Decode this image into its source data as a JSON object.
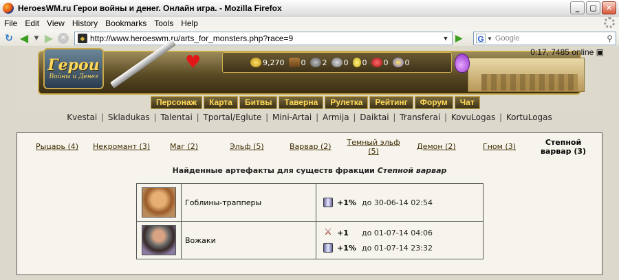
{
  "window": {
    "title": "HeroesWM.ru Герои войны и денег. Онлайн игра. - Mozilla Firefox",
    "minimize": "_",
    "maximize": "▢",
    "close": "✕"
  },
  "menubar": [
    "File",
    "Edit",
    "View",
    "History",
    "Bookmarks",
    "Tools",
    "Help"
  ],
  "nav": {
    "url": "http://www.heroeswm.ru/arts_for_monsters.php?race=9",
    "search_placeholder": "Google"
  },
  "game": {
    "logo_big": "Герои",
    "logo_small": "Войны и Денег",
    "online": "0:17, 7485 online",
    "resources": [
      {
        "name": "gold",
        "value": "9,270"
      },
      {
        "name": "wood",
        "value": "0"
      },
      {
        "name": "ore",
        "value": "2"
      },
      {
        "name": "mercury",
        "value": "0"
      },
      {
        "name": "sulfur",
        "value": "0"
      },
      {
        "name": "crystals",
        "value": "0"
      },
      {
        "name": "gems",
        "value": "0"
      }
    ],
    "menu": [
      "Персонаж",
      "Карта",
      "Битвы",
      "Таверна",
      "Рулетка",
      "Рейтинг",
      "Форум",
      "Чат"
    ],
    "sublinks": [
      "Kvestai",
      "Skladukas",
      "Talentai",
      "Tportal/Eglute",
      "Mini-Artai",
      "Armija",
      "Daiktai",
      "Transferai",
      "KovuLogas",
      "KortuLogas"
    ]
  },
  "factions": [
    {
      "label": "Рыцарь (4)"
    },
    {
      "label": "Некромант (3)"
    },
    {
      "label": "Маг (2)"
    },
    {
      "label": "Эльф (5)"
    },
    {
      "label": "Варвар (2)"
    },
    {
      "label": "Темный эльф (5)"
    },
    {
      "label": "Демон (2)"
    },
    {
      "label": "Гном (3)"
    },
    {
      "label": "Степной варвар (3)"
    }
  ],
  "heading": {
    "text": "Найденные артефакты для существ фракции ",
    "faction": "Степной варвар"
  },
  "rows": [
    {
      "unit": "Гоблины-трапперы",
      "bonuses": [
        {
          "icon": "scroll-icon",
          "value": "+1%",
          "until": "до 30-06-14 02:54"
        }
      ]
    },
    {
      "unit": "Вожаки",
      "bonuses": [
        {
          "icon": "swords-icon",
          "value": "+1",
          "until": "до 01-07-14 04:06"
        },
        {
          "icon": "scroll-icon",
          "value": "+1%",
          "until": "до 01-07-14 23:32"
        }
      ]
    }
  ]
}
